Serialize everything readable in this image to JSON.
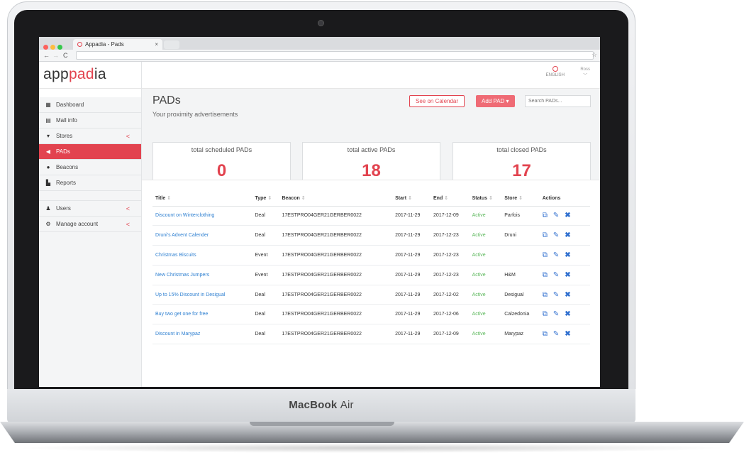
{
  "device": {
    "brand": "MacBook",
    "model": "Air"
  },
  "browser": {
    "tab_title": "Appadia - Pads",
    "tab_close": "×",
    "back": "←",
    "forward": "→",
    "reload": "C",
    "bookmark_icon": "☆"
  },
  "app": {
    "logo_part1": "app",
    "logo_part2": "pad",
    "logo_part3": "ia",
    "language": "ENGLISH",
    "user": "Ross",
    "user_caret": "﹀"
  },
  "sidebar": {
    "items": [
      {
        "label": "Dashboard",
        "icon": "▦",
        "icon_name": "dashboard-icon"
      },
      {
        "label": "Mall info",
        "icon": "▤",
        "icon_name": "building-icon"
      },
      {
        "label": "Stores",
        "icon": "▾",
        "icon_name": "cart-icon",
        "chevron": "<"
      },
      {
        "label": "PADs",
        "icon": "◀",
        "icon_name": "megaphone-icon",
        "active": true
      },
      {
        "label": "Beacons",
        "icon": "●",
        "icon_name": "map-marker-icon"
      },
      {
        "label": "Reports",
        "icon": "▙",
        "icon_name": "file-icon"
      }
    ],
    "secondary": [
      {
        "label": "Users",
        "icon": "♟",
        "icon_name": "user-icon",
        "chevron": "<"
      },
      {
        "label": "Manage account",
        "icon": "⚙",
        "icon_name": "gears-icon",
        "chevron": "<"
      }
    ]
  },
  "page": {
    "title": "PADs",
    "subtitle": "Your proximity advertisements",
    "see_calendar": "See on Calendar",
    "add_pad": "Add PAD ▾",
    "search_placeholder": "Search PADs..."
  },
  "stats": [
    {
      "label": "total scheduled PADs",
      "value": "0"
    },
    {
      "label": "total active PADs",
      "value": "18"
    },
    {
      "label": "total closed PADs",
      "value": "17"
    }
  ],
  "table": {
    "headers": [
      "Title",
      "Type",
      "Beacon",
      "Start",
      "End",
      "Status",
      "Store",
      "Actions"
    ],
    "sort_icon": "⇕",
    "rows": [
      {
        "title": "Discount on Winterclothing",
        "type": "Deal",
        "beacon": "17ESTPRO04GER21GERBER0022",
        "start": "2017-11-29",
        "end": "2017-12-09",
        "status": "Active",
        "store": "Parfois"
      },
      {
        "title": "Druni's Advent Calender",
        "type": "Deal",
        "beacon": "17ESTPRO04GER21GERBER0022",
        "start": "2017-11-29",
        "end": "2017-12-23",
        "status": "Active",
        "store": "Druni"
      },
      {
        "title": "Christmas Biscuits",
        "type": "Event",
        "beacon": "17ESTPRO04GER21GERBER0022",
        "start": "2017-11-29",
        "end": "2017-12-23",
        "status": "Active",
        "store": ""
      },
      {
        "title": "New Christmas Jumpers",
        "type": "Event",
        "beacon": "17ESTPRO04GER21GERBER0022",
        "start": "2017-11-29",
        "end": "2017-12-23",
        "status": "Active",
        "store": "H&M"
      },
      {
        "title": "Up to 15% Discount in Desigual",
        "type": "Deal",
        "beacon": "17ESTPRO04GER21GERBER0022",
        "start": "2017-11-29",
        "end": "2017-12-02",
        "status": "Active",
        "store": "Desigual"
      },
      {
        "title": "Buy two get one for free",
        "type": "Deal",
        "beacon": "17ESTPRO04GER21GERBER0022",
        "start": "2017-11-29",
        "end": "2017-12-06",
        "status": "Active",
        "store": "Calzedonia"
      },
      {
        "title": "Discount in Marypaz",
        "type": "Deal",
        "beacon": "17ESTPRO04GER21GERBER0022",
        "start": "2017-11-29",
        "end": "2017-12-09",
        "status": "Active",
        "store": "Marypaz"
      }
    ],
    "actions": {
      "copy": "⧉",
      "edit": "✎",
      "delete": "✖"
    }
  },
  "colors": {
    "accent": "#e2434f",
    "link": "#2f80d1",
    "active_status": "#5cb85c"
  }
}
